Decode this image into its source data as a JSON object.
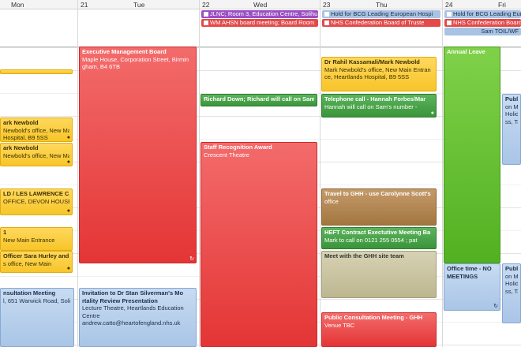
{
  "days": [
    {
      "num": "",
      "name": "Mon"
    },
    {
      "num": "21",
      "name": "Tue"
    },
    {
      "num": "22",
      "name": "Wed"
    },
    {
      "num": "23",
      "name": "Thu"
    },
    {
      "num": "24",
      "name": "Fri"
    }
  ],
  "allday": {
    "wed_1": "JLNC; Room 3, Education Centre, Solihu",
    "wed_2": "WM AHSN board meeting; Board Room",
    "thu_1": "Hold for BCG Leading European Hospi",
    "thu_2": "NHS Confederation Board of Truste",
    "fri_1": "Hold for BCG Leading Europ",
    "fri_2": "NHS Confederation Board",
    "fri_3": "Sam TOIL/WF"
  },
  "events": {
    "mon_a": {
      "l1": "",
      "l2": ""
    },
    "mon_b": {
      "l1": "ark Newbold",
      "l2": "Newbold's office, New Main Entran",
      "l3": "Hospital, B9 5SS"
    },
    "mon_c": {
      "l1": "ark Newbold",
      "l2": "Newbold's office, New Main Ent"
    },
    "mon_d": {
      "l1": "LD / LES LAWRENCE CA",
      "l2": "OFFICE, DEVON HOUSE,"
    },
    "mon_e": {
      "l1": "1",
      "l2": "New Main Entrance"
    },
    "mon_f": {
      "l1": "Officer Sara Hurley and",
      "l2": "s office, New Main"
    },
    "mon_g": {
      "l1": "nsultation Meeting",
      "l2": "l, 651 Warwick Road, Soli"
    },
    "tue_a": {
      "l1": "Executive Management Board",
      "l2": "Maple House, Corporation Street, Birmin",
      "l3": "gham, B4 6TB"
    },
    "tue_b": {
      "l1": "Invitation to Dr Stan Silverman's Mo",
      "l2": "rtality Review Presentation",
      "l3": "Lecture Theatre, Heartlands Education",
      "l4": "Centre",
      "l5": "andrew.catto@heartofengland.nhs.uk"
    },
    "wed_a": {
      "l1": "Richard Down; Richard will call on Sam'"
    },
    "wed_b": {
      "l1": "Staff Recognition Award",
      "l2": "Crescent Theatre"
    },
    "thu_a": {
      "l1": "Dr Rahil Kassamali/Mark Newbold",
      "l2": "Mark Newbold's office, New Main Entran",
      "l3": "ce, Heartlands Hospital, B9 5SS"
    },
    "thu_b": {
      "l1": "Telephone call - Hannah Forbes/Mar",
      "l2": "Hannah will call on Sam's number -"
    },
    "thu_c": {
      "l1": "Travel to GHH - use Carolynne Scott's",
      "l2": "office"
    },
    "thu_d": {
      "l1": "HEFT Contract Exectutive Meeting  Ba",
      "l2": "Mark to call on 0121 255 0554 ; pat"
    },
    "thu_e": {
      "l1": "Meet with the GHH site team"
    },
    "thu_f": {
      "l1": "Public Consultation Meeting - GHH",
      "l2": "Venue TBC"
    },
    "fri_a": {
      "l1": "Annual Leave"
    },
    "fri_b": {
      "l1": "Publi",
      "l2": "on Me",
      "l3": "Holid",
      "l4": "ss, Ta"
    },
    "fri_c": {
      "l1": "Office time - NO",
      "l2": "MEETINGS"
    },
    "fri_d": {
      "l1": "Publi",
      "l2": "on Me",
      "l3": "Holid",
      "l4": "ss, Ta"
    }
  }
}
